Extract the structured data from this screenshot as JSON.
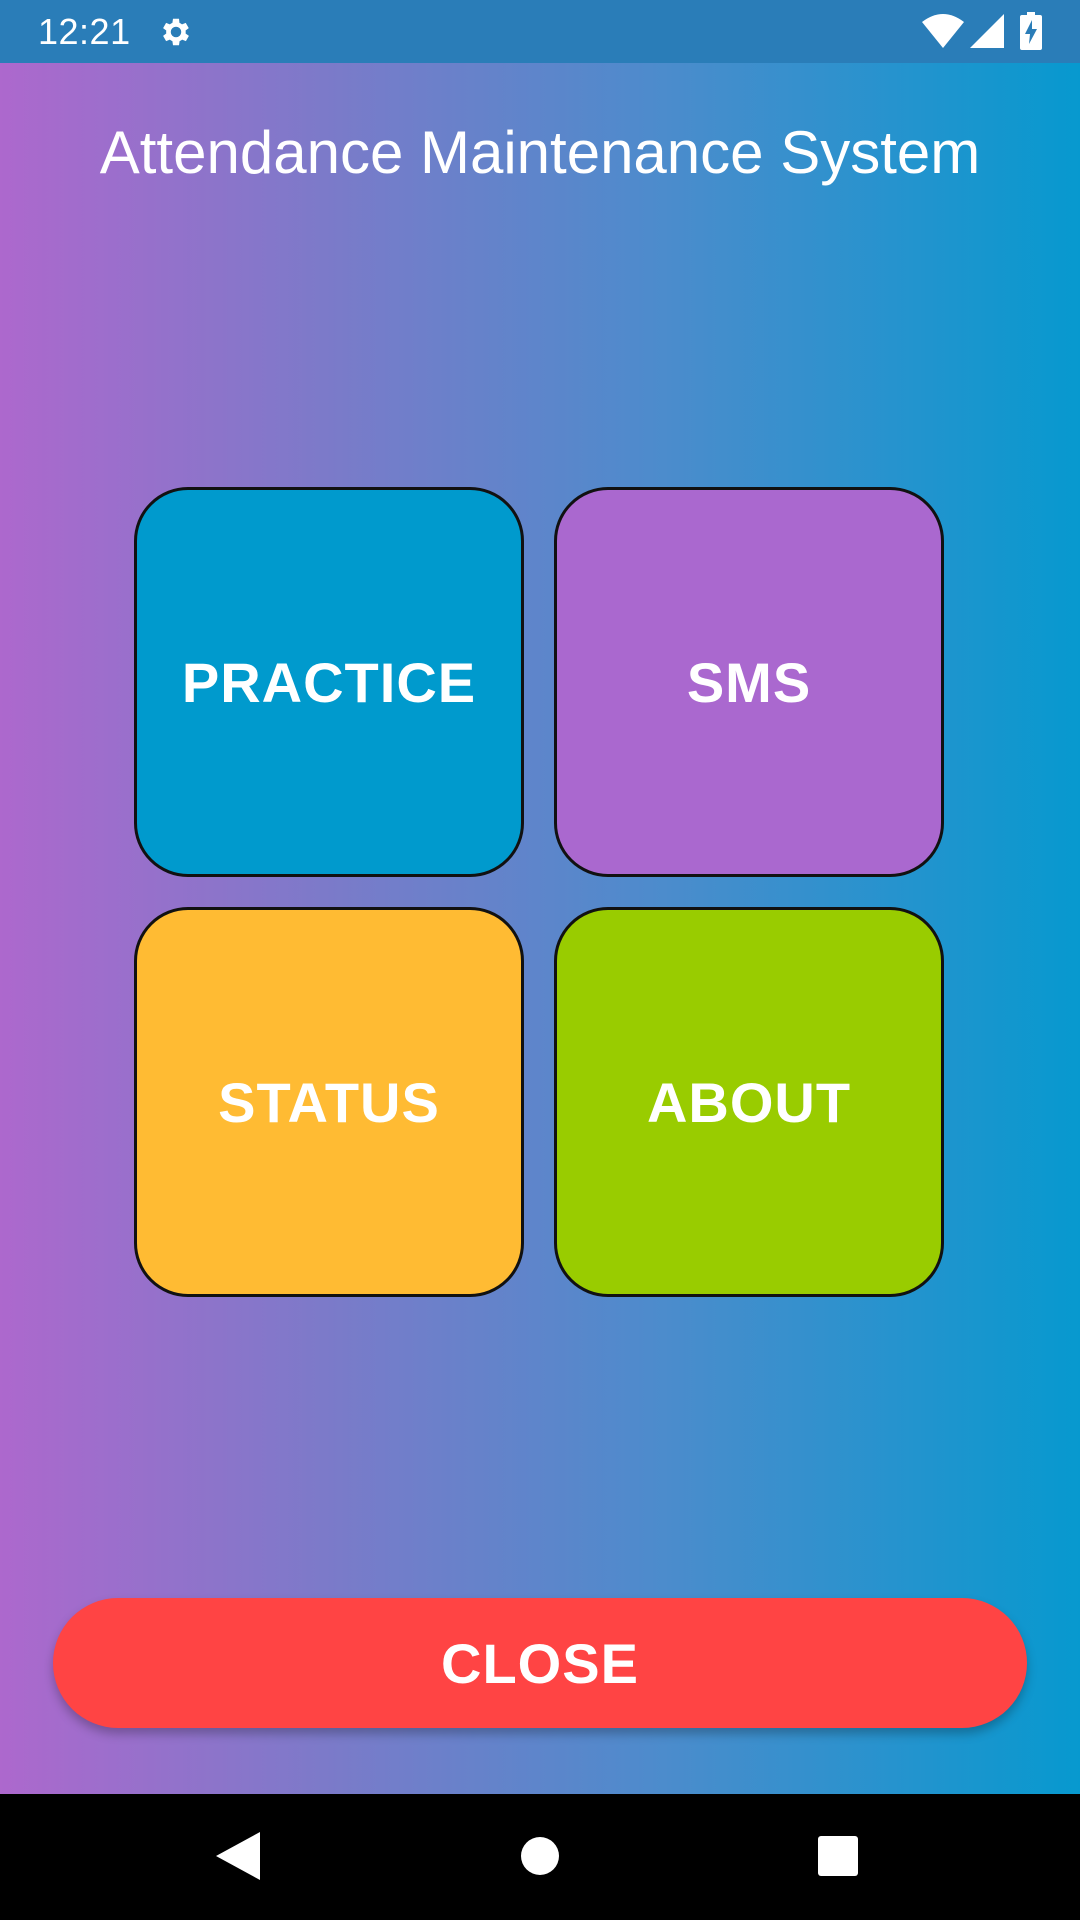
{
  "status_bar": {
    "time": "12:21",
    "icons": [
      "gear-icon",
      "wifi-icon",
      "signal-icon",
      "battery-charging-icon"
    ]
  },
  "app": {
    "title": "Attendance Maintenance System"
  },
  "tiles": [
    {
      "label": "PRACTICE",
      "color": "#009acd"
    },
    {
      "label": "SMS",
      "color": "#aa68cf"
    },
    {
      "label": "STATUS",
      "color": "#ffbb33"
    },
    {
      "label": "ABOUT",
      "color": "#99cc00"
    }
  ],
  "close_button": {
    "label": "CLOSE",
    "color": "#ff4444"
  },
  "nav_bar": {
    "icons": [
      "back-icon",
      "home-icon",
      "recents-icon"
    ]
  },
  "colors": {
    "status_bar": "#2a7db8",
    "gradient_start": "#ad68cd",
    "gradient_end": "#0799cf",
    "nav_bar": "#000000"
  }
}
